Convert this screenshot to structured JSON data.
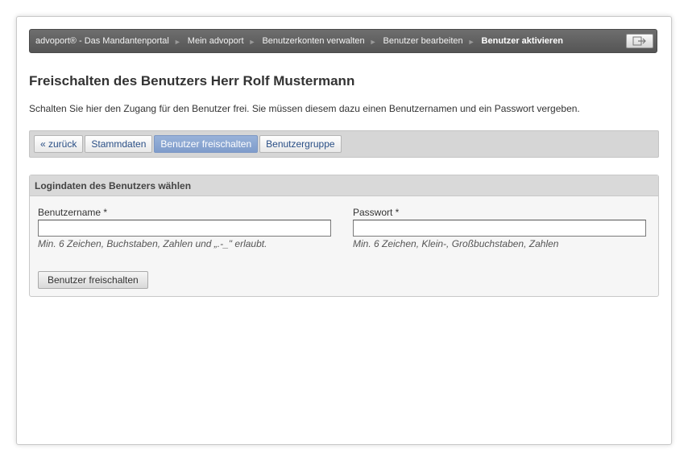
{
  "breadcrumb": {
    "items": [
      {
        "label": "advoport® - Das Mandantenportal"
      },
      {
        "label": "Mein advoport"
      },
      {
        "label": "Benutzerkonten verwalten"
      },
      {
        "label": "Benutzer bearbeiten"
      },
      {
        "label": "Benutzer aktivieren"
      }
    ],
    "separator": "►",
    "logout_icon": "logout-icon"
  },
  "page": {
    "title": "Freischalten des Benutzers Herr Rolf Mustermann",
    "intro": "Schalten Sie hier den Zugang für den Benutzer frei. Sie müssen diesem dazu einen Benutzernamen und ein Passwort vergeben."
  },
  "tabs": [
    {
      "label": "« zurück",
      "active": false
    },
    {
      "label": "Stammdaten",
      "active": false
    },
    {
      "label": "Benutzer freischalten",
      "active": true
    },
    {
      "label": "Benutzergruppe",
      "active": false
    }
  ],
  "form": {
    "heading": "Logindaten des Benutzers wählen",
    "username": {
      "label": "Benutzername *",
      "value": "",
      "hint": "Min. 6 Zeichen, Buchstaben, Zahlen und „.-_\" erlaubt."
    },
    "password": {
      "label": "Passwort *",
      "value": "",
      "hint": "Min. 6 Zeichen, Klein-, Großbuchstaben, Zahlen"
    },
    "submit_label": "Benutzer freischalten"
  },
  "colors": {
    "breadcrumb_bg": "#5f5f5f",
    "tab_active_bg": "#8aa6d2",
    "link_color": "#2a4f86"
  }
}
